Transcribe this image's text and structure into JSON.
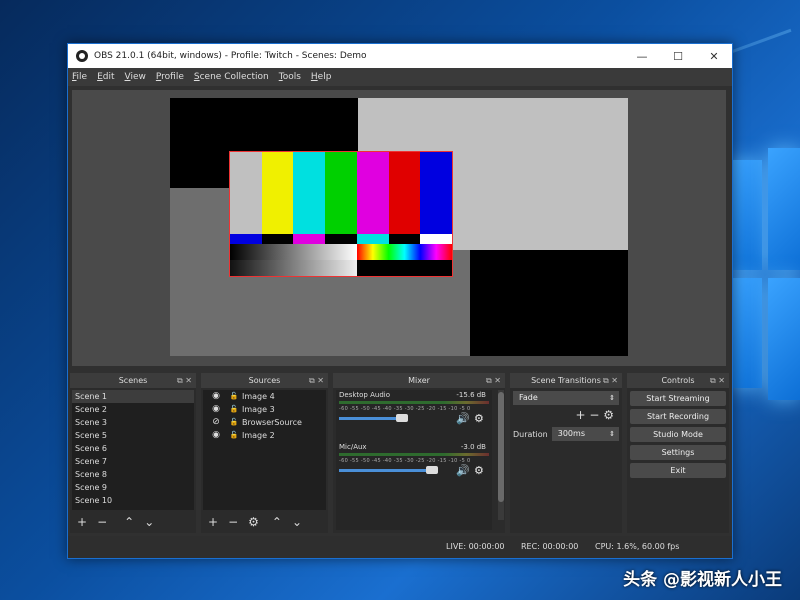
{
  "window": {
    "title": "OBS 21.0.1 (64bit, windows) - Profile: Twitch - Scenes: Demo",
    "minimize": "—",
    "maximize": "☐",
    "close": "✕"
  },
  "menu": [
    {
      "u": "F",
      "rest": "ile"
    },
    {
      "u": "E",
      "rest": "dit"
    },
    {
      "u": "V",
      "rest": "iew"
    },
    {
      "u": "P",
      "rest": "rofile"
    },
    {
      "u": "S",
      "rest": "cene Collection"
    },
    {
      "u": "T",
      "rest": "ools"
    },
    {
      "u": "H",
      "rest": "elp"
    }
  ],
  "scenes": {
    "header": "Scenes",
    "items": [
      "Scene 1",
      "Scene 2",
      "Scene 3",
      "Scene 5",
      "Scene 6",
      "Scene 7",
      "Scene 8",
      "Scene 9",
      "Scene 10"
    ],
    "selected": 0
  },
  "sources": {
    "header": "Sources",
    "items": [
      {
        "name": "Image 4",
        "visible": true
      },
      {
        "name": "Image 3",
        "visible": true
      },
      {
        "name": "BrowserSource",
        "visible": false
      },
      {
        "name": "Image 2",
        "visible": true
      }
    ]
  },
  "mixer": {
    "header": "Mixer",
    "tracks": [
      {
        "name": "Desktop Audio",
        "db": "-15.6 dB",
        "level": 0.6
      },
      {
        "name": "Mic/Aux",
        "db": "-3.0 dB",
        "level": 0.9
      }
    ],
    "ticks": "-60 -55 -50 -45 -40 -35 -30 -25 -20 -15 -10 -5  0"
  },
  "transitions": {
    "header": "Scene Transitions",
    "selected": "Fade",
    "duration_label": "Duration",
    "duration_value": "300ms"
  },
  "controls": {
    "header": "Controls",
    "buttons": [
      "Start Streaming",
      "Start Recording",
      "Studio Mode",
      "Settings",
      "Exit"
    ]
  },
  "status": {
    "live": "LIVE: 00:00:00",
    "rec": "REC: 00:00:00",
    "cpu": "CPU: 1.6%, 60.00 fps"
  },
  "watermark": "头条 @影视新人小王",
  "colors": {
    "accent": "#1a6fd0",
    "panel": "#2b2b2b",
    "bg": "#303030"
  }
}
